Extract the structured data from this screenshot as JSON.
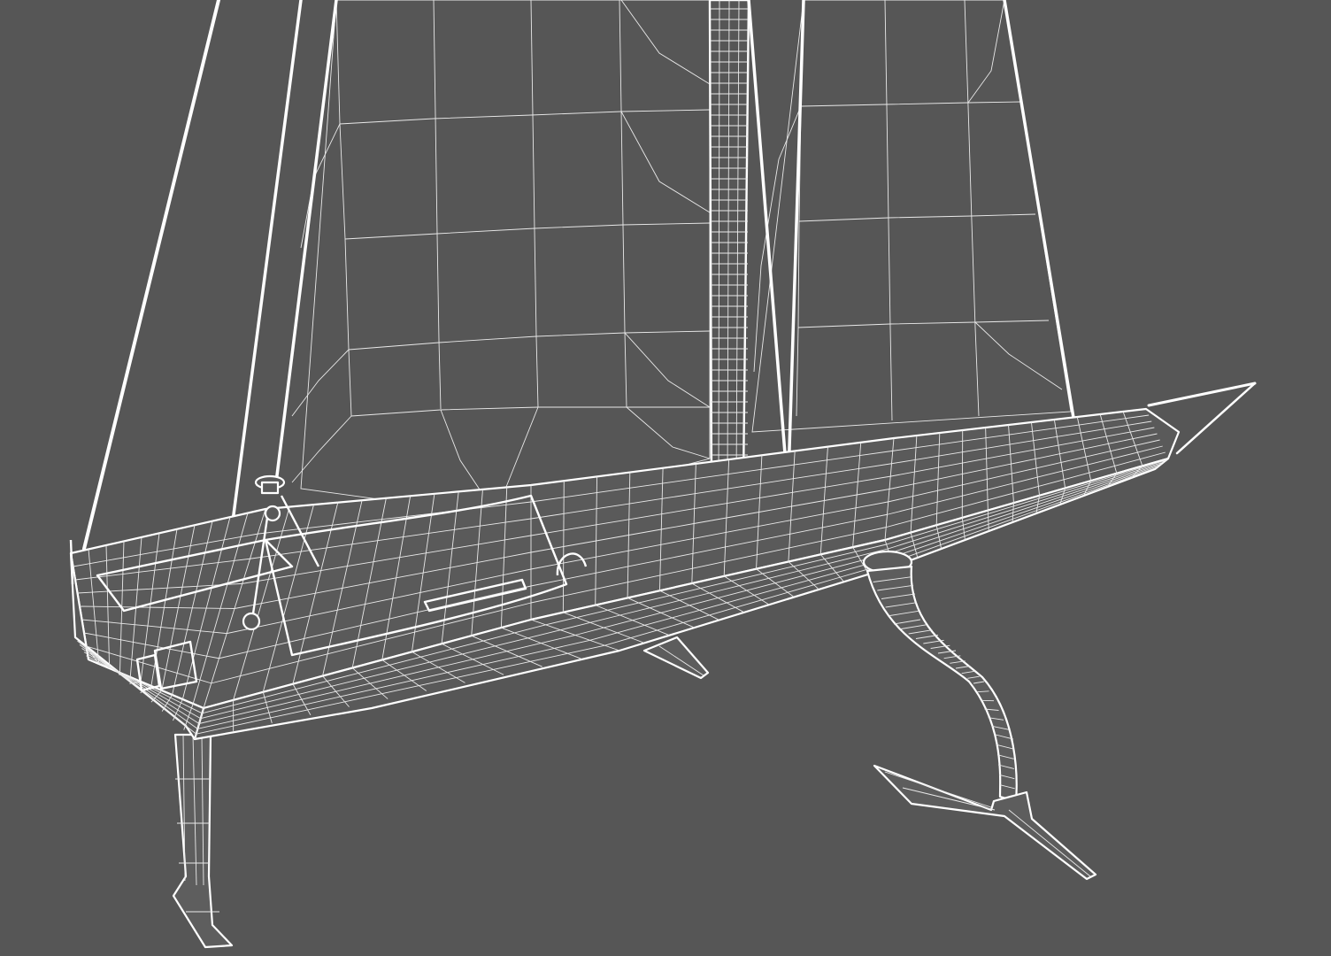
{
  "scene": {
    "subject": "",
    "background_color": "#565656",
    "wire_color": "#ffffff"
  }
}
